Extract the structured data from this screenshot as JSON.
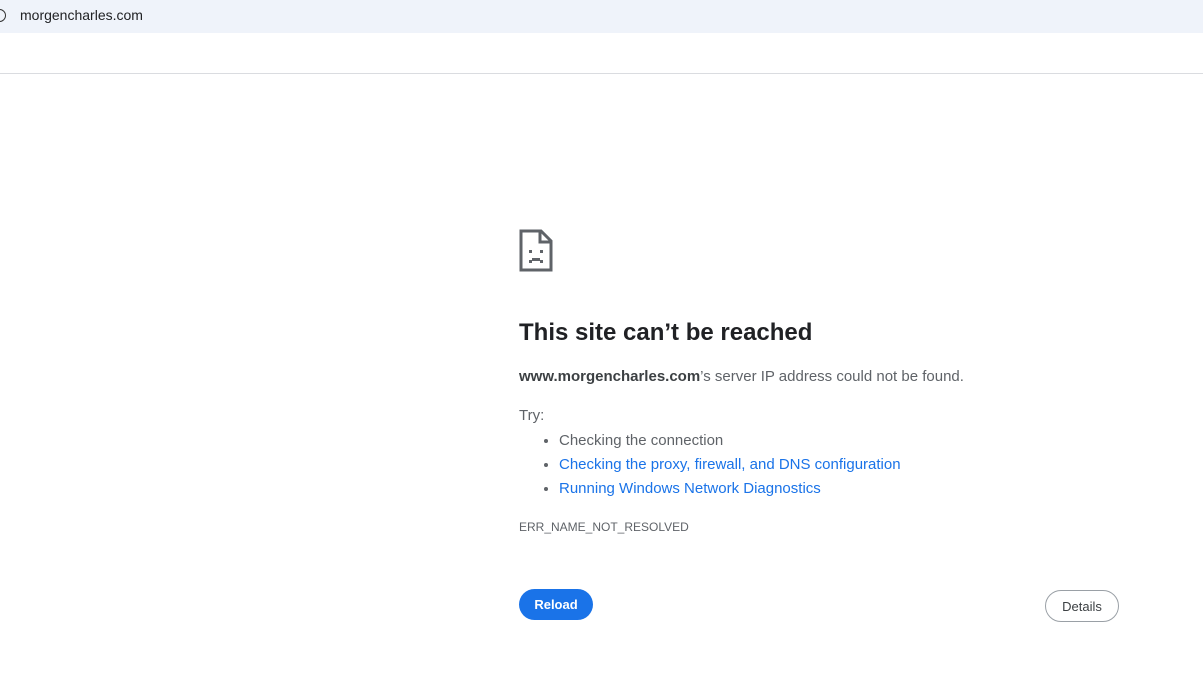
{
  "address_bar": {
    "url": "morgencharles.com"
  },
  "error_page": {
    "title": "This site can’t be reached",
    "host": "www.morgencharles.com",
    "summary_suffix": "’s server IP address could not be found.",
    "try_label": "Try:",
    "suggestions": [
      {
        "text": "Checking the connection",
        "link": false
      },
      {
        "text": "Checking the proxy, firewall, and DNS configuration",
        "link": true
      },
      {
        "text": "Running Windows Network Diagnostics",
        "link": true
      }
    ],
    "error_code": "ERR_NAME_NOT_RESOLVED",
    "reload_label": "Reload",
    "details_label": "Details"
  },
  "icons": {
    "site_info": "info-icon",
    "error": "sad-page-icon"
  },
  "colors": {
    "link": "#1a73e8",
    "primary_button": "#1a73e8"
  }
}
